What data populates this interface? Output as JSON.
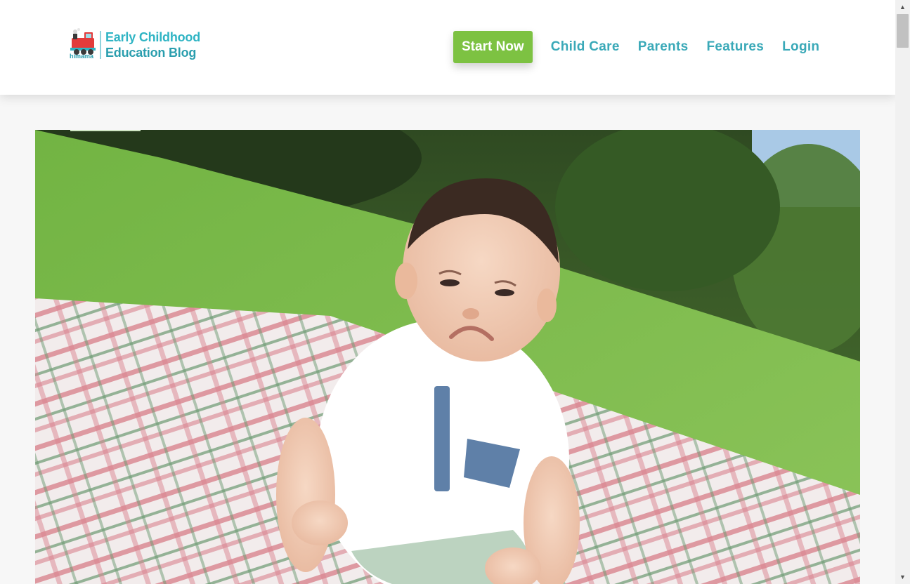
{
  "brand": {
    "line1": "Early Childhood",
    "line2": "Education Blog",
    "sub": "himama",
    "logo_icon": "toy-train-icon"
  },
  "nav": {
    "cta": "Start Now",
    "links": [
      "Child Care",
      "Parents",
      "Features",
      "Login"
    ]
  },
  "colors": {
    "cta_bg": "#7dc242",
    "nav_link": "#3aa9b8",
    "brand_text": "#2fb4c4"
  },
  "hero": {
    "icon": "baby-on-picnic-blanket-photo"
  },
  "scrollbar": {
    "up": "▲",
    "down": "▼"
  }
}
